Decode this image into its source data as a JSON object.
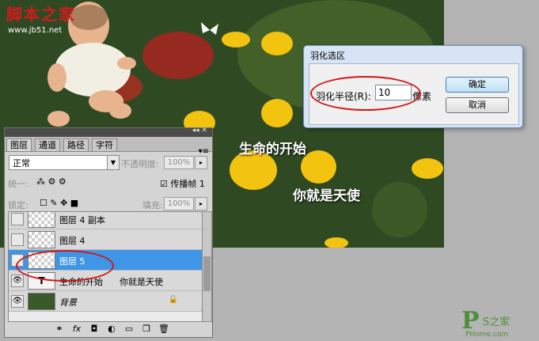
{
  "watermark": {
    "site": "脚本之家",
    "url": "www.jb51.net"
  },
  "canvas_texts": [
    "生命的开始",
    "你就是天使"
  ],
  "dialog": {
    "title": "羽化选区",
    "radius_label": "羽化半径(R):",
    "radius_value": "10",
    "unit": "像素",
    "ok_label": "确定",
    "cancel_label": "取消"
  },
  "layers_panel": {
    "tabs": [
      "图层",
      "通道",
      "路径",
      "字符"
    ],
    "blend_mode": "正常",
    "opacity_label": "不透明度:",
    "opacity_value": "100%",
    "unify_label": "统一:",
    "propagate_label": "传播帧 1",
    "lock_label": "锁定:",
    "fill_label": "填充:",
    "fill_value": "100%",
    "layers": [
      {
        "name": "图层 4 副本",
        "thumb": "transparent",
        "visible": false,
        "selected": false
      },
      {
        "name": "图层 4",
        "thumb": "transparent",
        "visible": false,
        "selected": false
      },
      {
        "name": "图层 5",
        "thumb": "transparent",
        "visible": true,
        "selected": true
      },
      {
        "name": "生命的开始      你就是天使",
        "thumb": "text",
        "thumb_text": "T",
        "visible": true,
        "selected": false
      },
      {
        "name": "背景",
        "thumb": "image",
        "visible": true,
        "selected": false,
        "locked": true
      }
    ]
  },
  "corner_logo": {
    "main": "P",
    "sub": "S之家",
    "small": "PHome.com"
  }
}
